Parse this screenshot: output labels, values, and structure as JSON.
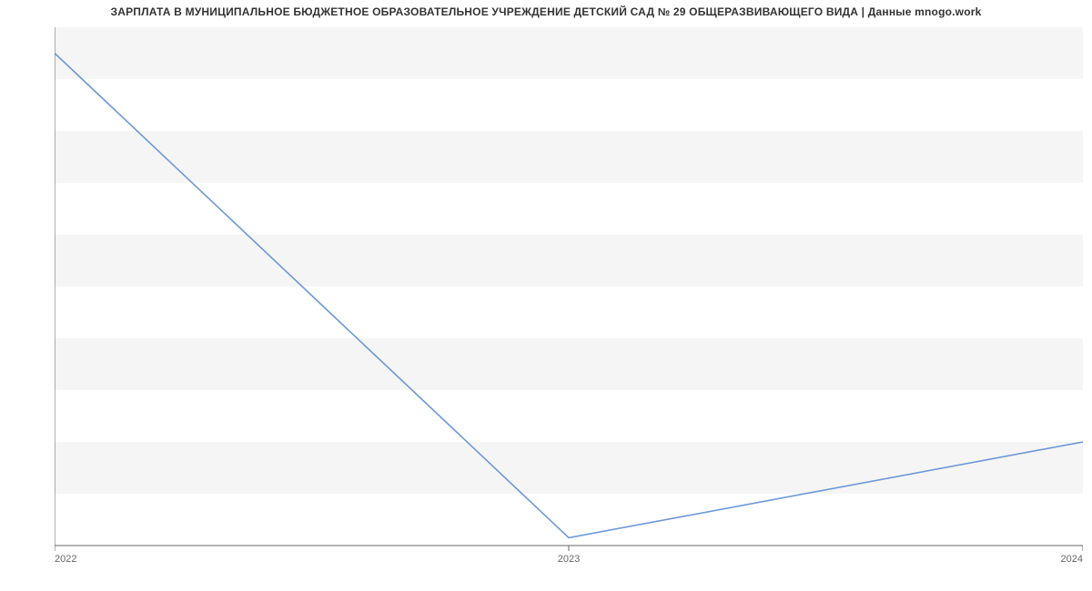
{
  "title": "ЗАРПЛАТА В МУНИЦИПАЛЬНОЕ БЮДЖЕТНОЕ ОБРАЗОВАТЕЛЬНОЕ УЧРЕЖДЕНИЕ ДЕТСКИЙ САД № 29 ОБЩЕРАЗВИВАЮЩЕГО ВИДА | Данные mnogo.work",
  "chart_data": {
    "type": "line",
    "title": "ЗАРПЛАТА В МУНИЦИПАЛЬНОЕ БЮДЖЕТНОЕ ОБРАЗОВАТЕЛЬНОЕ УЧРЕЖДЕНИЕ ДЕТСКИЙ САД № 29 ОБЩЕРАЗВИВАЮЩЕГО ВИДА | Данные mnogo.work",
    "xlabel": "",
    "ylabel": "",
    "x": [
      2022,
      2023,
      2024
    ],
    "values": [
      35000,
      16300,
      20000
    ],
    "ylim": [
      16000,
      36000
    ],
    "yticks": [
      16000,
      18000,
      20000,
      22000,
      24000,
      26000,
      28000,
      30000,
      32000,
      34000,
      36000
    ],
    "xticks": [
      2022,
      2023,
      2024
    ],
    "xtick_labels": [
      "2022",
      "2023",
      "2024"
    ],
    "grid": true,
    "colors": {
      "line": "#6c98d6",
      "band": "#f5f5f5"
    }
  }
}
